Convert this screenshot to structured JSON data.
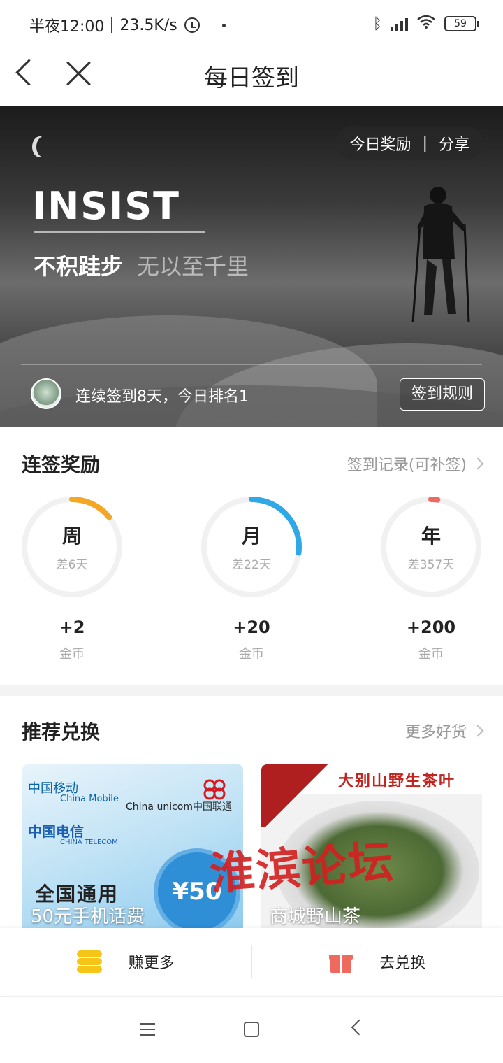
{
  "status_bar": {
    "time": "半夜12:00",
    "speed": "23.5K/s",
    "battery": "59",
    "icons": [
      "alarm-icon",
      "bluetooth-icon",
      "signal-icon",
      "wifi-icon",
      "battery-icon"
    ]
  },
  "nav": {
    "title": "每日签到",
    "icons": [
      "back-icon",
      "close-icon"
    ]
  },
  "banner": {
    "pill_reward": "今日奖励",
    "pill_sep": "|",
    "pill_share": "分享",
    "headline": "INSIST",
    "motto_a": "不积跬步",
    "motto_b": "无以至千里",
    "streak_text": "连续签到8天，今日排名1",
    "rules_button": "签到规则"
  },
  "streak_section": {
    "title": "连签奖励",
    "link": "签到记录(可补签)",
    "rings": [
      {
        "label": "周",
        "sub": "差6天",
        "coins": "+2",
        "coin_label": "金币",
        "progress": 0.143,
        "color": "#f5a623"
      },
      {
        "label": "月",
        "sub": "差22天",
        "coins": "+20",
        "coin_label": "金币",
        "progress": 0.27,
        "color": "#2ea8e6"
      },
      {
        "label": "年",
        "sub": "差357天",
        "coins": "+200",
        "coin_label": "金币",
        "progress": 0.022,
        "color": "#ee6a5e"
      }
    ]
  },
  "exchange_section": {
    "title": "推荐兑换",
    "link": "更多好货",
    "products": [
      {
        "title": "50元手机话费",
        "cm_cn": "中国移动",
        "cm_en": "China Mobile",
        "ct_cn": "中国电信",
        "ct_en": "CHINA TELECOM",
        "cu": "China unicom中国联通",
        "general": "全国通用",
        "price": "¥50"
      },
      {
        "title": "商城野山茶",
        "banner": "大别山野生茶叶"
      }
    ],
    "watermark": "淮滨论坛"
  },
  "action_bar": {
    "earn": "赚更多",
    "redeem": "去兑换"
  },
  "colors": {
    "week": "#f5a623",
    "month": "#2ea8e6",
    "year": "#ee6a5e",
    "watermark": "#d41f1f"
  }
}
